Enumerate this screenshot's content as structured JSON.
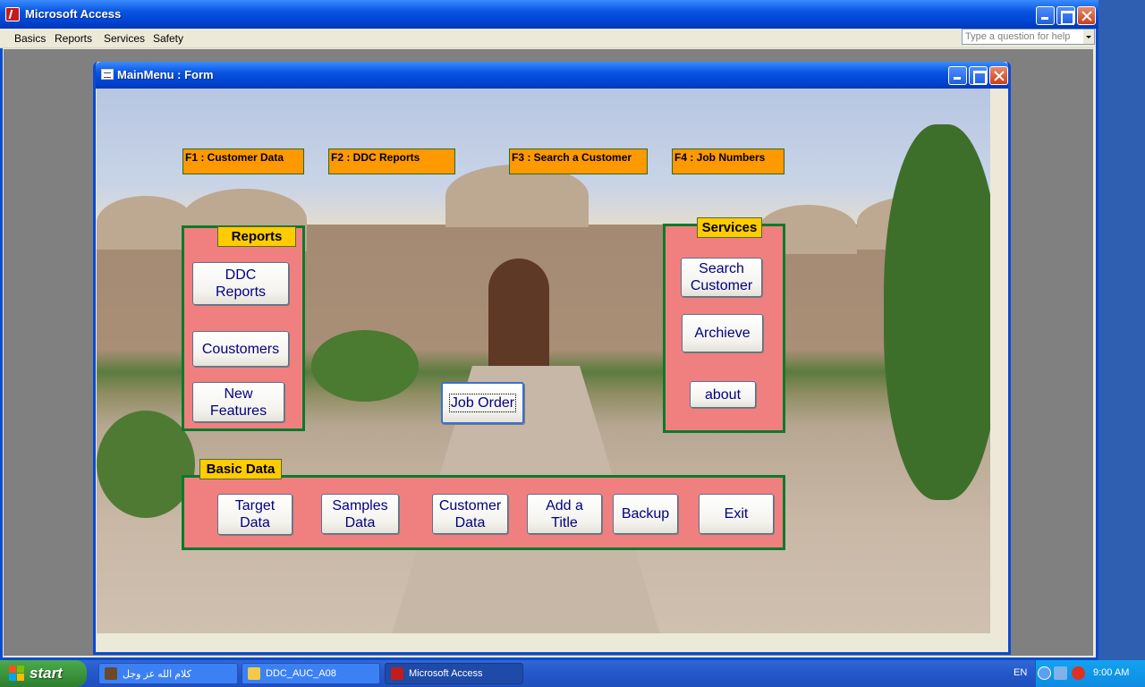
{
  "app": {
    "title": "Microsoft Access",
    "menu": [
      "Basics",
      "Reports",
      "Services",
      "Safety"
    ],
    "help_placeholder": "Type a question for help"
  },
  "form": {
    "title": "MainMenu : Form",
    "function_keys": [
      "F1 : Customer Data",
      "F2 : DDC Reports",
      "F3 : Search a Customer",
      "F4 : Job Numbers"
    ],
    "reports": {
      "title": "Reports",
      "buttons": {
        "ddc_reports_1": "DDC",
        "ddc_reports_2": "Reports",
        "customers": "Coustomers",
        "new_features_1": "New",
        "new_features_2": "Features"
      }
    },
    "services": {
      "title": "Services",
      "buttons": {
        "search_customer_1": "Search",
        "search_customer_2": "Customer",
        "archieve": "Archieve",
        "about": "about"
      }
    },
    "job_order": "Job Order",
    "basic_data": {
      "title": "Basic Data",
      "buttons": {
        "target_data_1": "Target",
        "target_data_2": "Data",
        "samples_data_1": "Samples",
        "samples_data_2": "Data",
        "customer_data_1": "Customer",
        "customer_data_2": "Data",
        "add_title_1": "Add a",
        "add_title_2": "Title",
        "backup": "Backup",
        "exit": "Exit"
      }
    }
  },
  "taskbar": {
    "start": "start",
    "tasks": [
      "كلام الله عز وجل",
      "DDC_AUC_A08",
      "Microsoft Access"
    ],
    "language": "EN",
    "clock": "9:00 AM"
  },
  "colors": {
    "panel_fill": "#F08080",
    "panel_border": "#0b7a2a",
    "panel_title": "#FFCC00",
    "fkey_fill": "#FF9900",
    "button_text": "#000080"
  }
}
